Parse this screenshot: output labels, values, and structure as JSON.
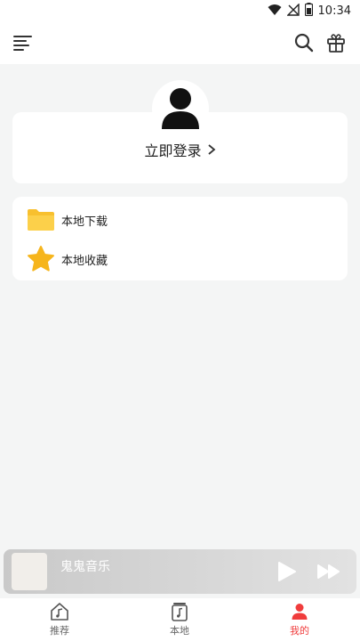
{
  "status_bar": {
    "time": "10:34"
  },
  "login": {
    "label": "立即登录"
  },
  "menu": {
    "items": [
      {
        "label": "本地下载",
        "icon": "folder-icon"
      },
      {
        "label": "本地收藏",
        "icon": "star-icon"
      }
    ]
  },
  "player": {
    "title": "鬼鬼音乐"
  },
  "bottom_nav": {
    "items": [
      {
        "label": "推荐",
        "icon": "home-music-icon",
        "active": false
      },
      {
        "label": "本地",
        "icon": "music-file-icon",
        "active": false
      },
      {
        "label": "我的",
        "icon": "user-icon",
        "active": true
      }
    ]
  },
  "colors": {
    "accent": "#f03c3c",
    "background": "#f4f5f5",
    "folder": "#f8c02e",
    "star": "#f6b51c"
  }
}
